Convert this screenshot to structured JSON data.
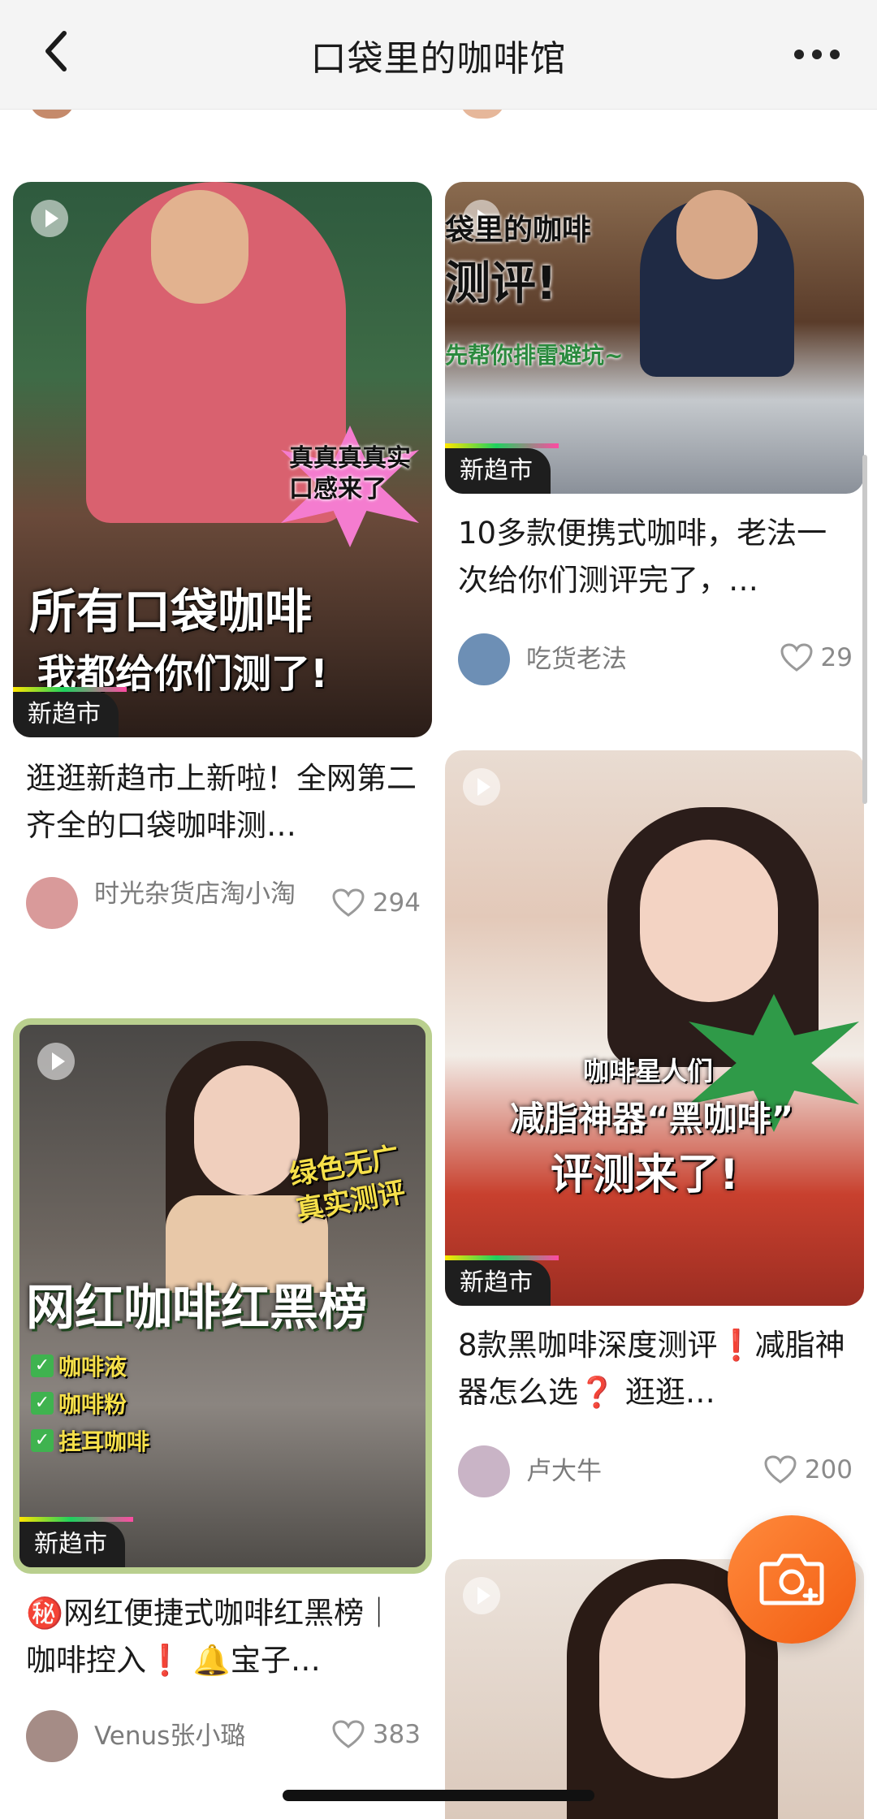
{
  "header": {
    "title": "口袋里的咖啡馆"
  },
  "cards": [
    {
      "tag": "新趋市",
      "overlay_top": "真真真真实\n口感来了",
      "overlay_line1": "所有口袋咖啡",
      "overlay_line2": "我都给你们测了!",
      "title": "逛逛新趋市上新啦！全网第二齐全的口袋咖啡测…",
      "author": "时光杂货店淘小淘",
      "likes": "294"
    },
    {
      "tag": "新趋市",
      "overlay_line1": "袋里的咖啡",
      "overlay_line2": "测评!",
      "overlay_line3": "先帮你排雷避坑~",
      "title": "10多款便携式咖啡，老法一次给你们测评完了，…",
      "author": "吃货老法",
      "likes": "29"
    },
    {
      "tag": "新趋市",
      "overlay_line1": "咖啡星人们",
      "overlay_line2": "减脂神器“黑咖啡”",
      "overlay_line3": "评测来了!",
      "title": "8款黑咖啡深度测评❗️减脂神器怎么选❓ 逛逛…",
      "author": "卢大牛",
      "likes": "200"
    },
    {
      "tag": "新趋市",
      "overlay_top": "绿色无广\n真实测评",
      "overlay_line1": "网红咖啡红黑榜",
      "checks": [
        "咖啡液",
        "咖啡粉",
        "挂耳咖啡"
      ],
      "title": "㊙️网红便捷式咖啡红黑榜｜咖啡控入❗️ 🔔宝子…",
      "author": "Venus张小璐",
      "likes": "383"
    }
  ],
  "colors": {
    "accent_orange": "#f25d12",
    "tag_bg": "#1e1e1e",
    "tag_pink": "#ff49a3"
  }
}
